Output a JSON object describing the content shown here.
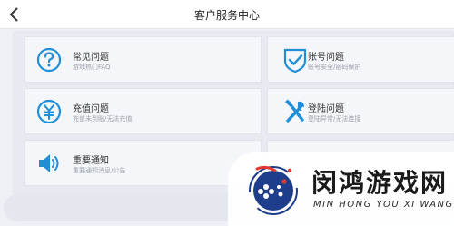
{
  "header": {
    "title": "客户服务中心"
  },
  "cards": [
    {
      "title": "常见问题",
      "desc": "游戏热门FAQ",
      "icon": "question-circle-icon"
    },
    {
      "title": "账号问题",
      "desc": "账号安全/密码保护",
      "icon": "shield-check-icon"
    },
    {
      "title": "充值问题",
      "desc": "充值未到账/无法充值",
      "icon": "yuan-circle-icon"
    },
    {
      "title": "登陆问题",
      "desc": "登陆异常/无法连接",
      "icon": "tools-icon"
    },
    {
      "title": "重要通知",
      "desc": "重要通知消息/公告",
      "icon": "speaker-icon"
    },
    {
      "title": "",
      "desc": "",
      "icon": ""
    }
  ],
  "watermark": {
    "text": "闵鸿游戏网",
    "subtext": "MIN HONG YOU XI WANG"
  },
  "colors": {
    "accent": "#1f8fd8",
    "background": "#eef0f5",
    "card": "#f5f6f9",
    "header": "#ffffff"
  }
}
